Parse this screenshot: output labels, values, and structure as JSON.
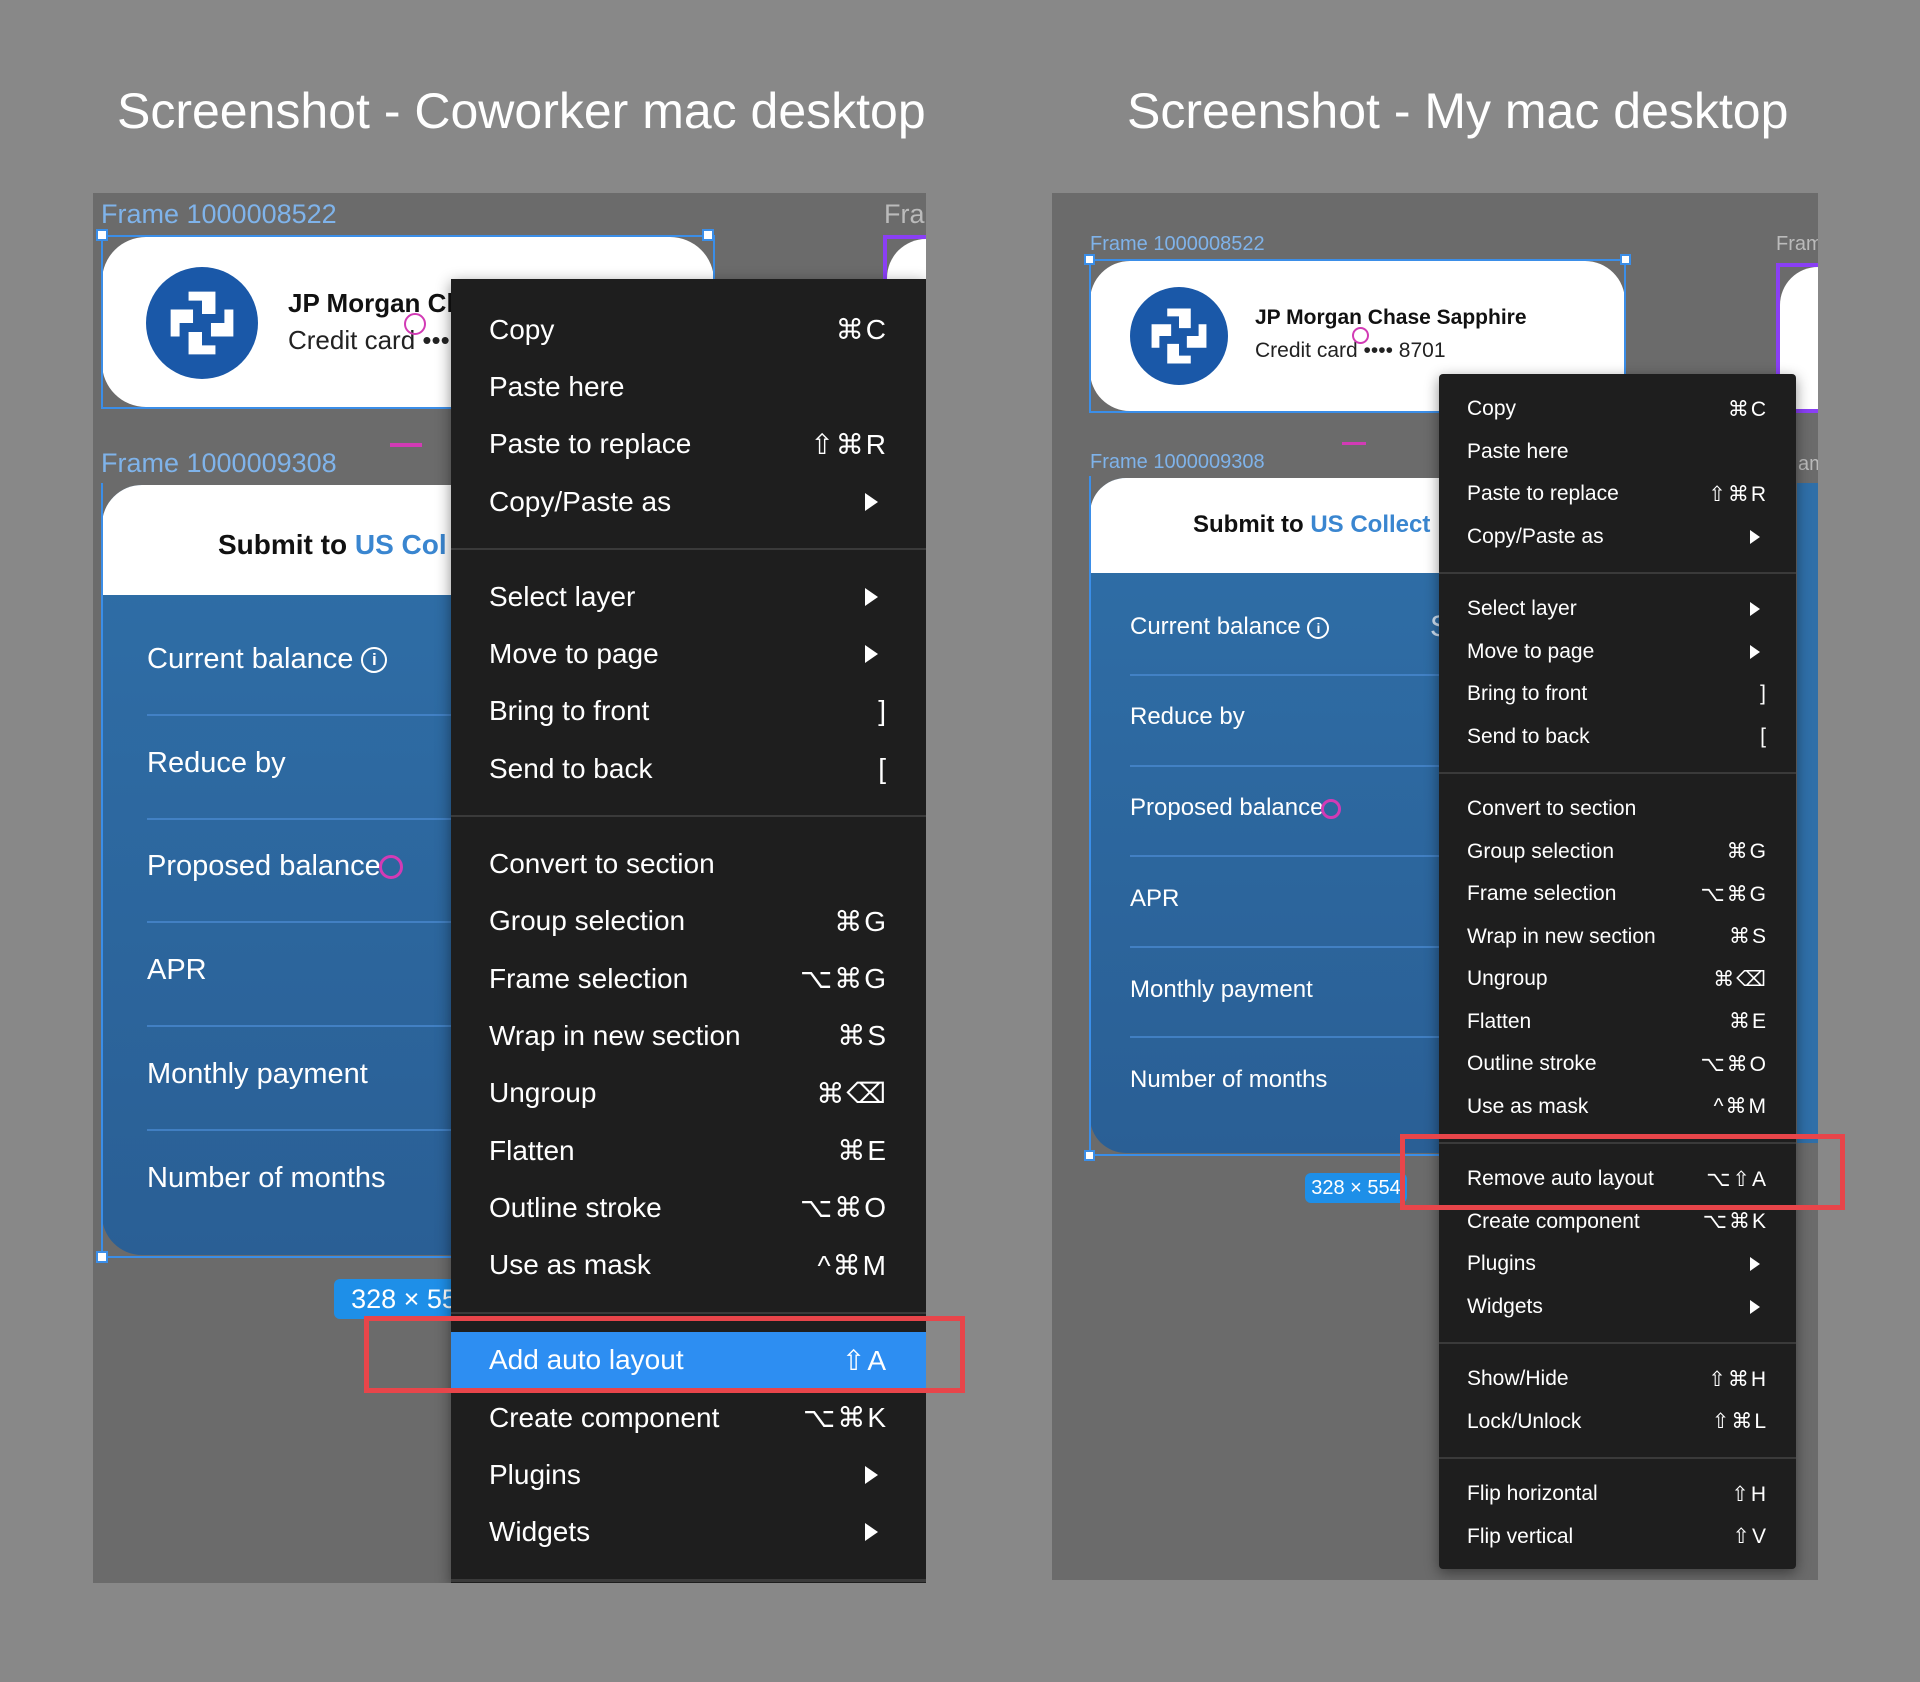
{
  "titles": {
    "left": "Screenshot - Coworker mac desktop",
    "right": "Screenshot - My mac desktop"
  },
  "colors": {
    "canvas_bg": "#6b6b6b",
    "page_bg": "#888888",
    "selection_blue": "#3b8ee8",
    "menu_bg": "#1e1e1e",
    "menu_highlight": "#2d8ef2",
    "annotation_red": "#e8454a",
    "form_blue": "#2f6fa8",
    "accent_text": "#3a86d0",
    "cursor_pink": "#d23bb5",
    "frame_purple": "#8a3ff5"
  },
  "left": {
    "frame1_label": "Frame 1000008522",
    "frame2_label": "Frame 1000009308",
    "frame3_label": "Fra",
    "card": {
      "bank_name": "JP Morgan Ch",
      "subtitle": "Credit card •••"
    },
    "form": {
      "header_prefix": "Submit to ",
      "header_accent": "US Col",
      "rows": [
        "Current balance",
        "Reduce by",
        "Proposed balance",
        "APR",
        "Monthly payment",
        "Number of months"
      ]
    },
    "dimension_badge": "328 × 55",
    "menu": {
      "items": [
        {
          "label": "Copy",
          "shortcut": "⌘C"
        },
        {
          "label": "Paste here",
          "shortcut": ""
        },
        {
          "label": "Paste to replace",
          "shortcut": "⇧⌘R"
        },
        {
          "label": "Copy/Paste as",
          "submenu": true
        },
        {
          "label": "Select layer",
          "submenu": true
        },
        {
          "label": "Move to page",
          "submenu": true
        },
        {
          "label": "Bring to front",
          "shortcut": "]"
        },
        {
          "label": "Send to back",
          "shortcut": "["
        },
        {
          "label": "Convert to section",
          "shortcut": ""
        },
        {
          "label": "Group selection",
          "shortcut": "⌘G"
        },
        {
          "label": "Frame selection",
          "shortcut": "⌥⌘G"
        },
        {
          "label": "Wrap in new section",
          "shortcut": "⌘S"
        },
        {
          "label": "Ungroup",
          "shortcut": "⌘⌫"
        },
        {
          "label": "Flatten",
          "shortcut": "⌘E"
        },
        {
          "label": "Outline stroke",
          "shortcut": "⌥⌘O"
        },
        {
          "label": "Use as mask",
          "shortcut": "^⌘M"
        },
        {
          "label": "Add auto layout",
          "shortcut": "⇧A",
          "highlighted": true
        },
        {
          "label": "Create component",
          "shortcut": "⌥⌘K"
        },
        {
          "label": "Plugins",
          "submenu": true
        },
        {
          "label": "Widgets",
          "submenu": true
        }
      ]
    }
  },
  "right": {
    "frame1_label": "Frame 1000008522",
    "frame2_label": "Frame 1000009308",
    "frame3_label": "Fram",
    "frame4_label": "am",
    "card": {
      "bank_name": "JP Morgan Chase Sapphire",
      "subtitle": "Credit card •••• 8701"
    },
    "form": {
      "header_prefix": "Submit to ",
      "header_accent": "US Collect",
      "rows": [
        "Current balance",
        "Reduce by",
        "Proposed balance",
        "APR",
        "Monthly payment",
        "Number of months"
      ],
      "clipped_value": "S"
    },
    "dimension_badge": "328 × 554",
    "menu": {
      "items": [
        {
          "label": "Copy",
          "shortcut": "⌘C"
        },
        {
          "label": "Paste here",
          "shortcut": ""
        },
        {
          "label": "Paste to replace",
          "shortcut": "⇧⌘R"
        },
        {
          "label": "Copy/Paste as",
          "submenu": true
        },
        {
          "label": "Select layer",
          "submenu": true
        },
        {
          "label": "Move to page",
          "submenu": true
        },
        {
          "label": "Bring to front",
          "shortcut": "]"
        },
        {
          "label": "Send to back",
          "shortcut": "["
        },
        {
          "label": "Convert to section",
          "shortcut": ""
        },
        {
          "label": "Group selection",
          "shortcut": "⌘G"
        },
        {
          "label": "Frame selection",
          "shortcut": "⌥⌘G"
        },
        {
          "label": "Wrap in new section",
          "shortcut": "⌘S"
        },
        {
          "label": "Ungroup",
          "shortcut": "⌘⌫"
        },
        {
          "label": "Flatten",
          "shortcut": "⌘E"
        },
        {
          "label": "Outline stroke",
          "shortcut": "⌥⌘O"
        },
        {
          "label": "Use as mask",
          "shortcut": "^⌘M"
        },
        {
          "label": "Remove auto layout",
          "shortcut": "⌥⇧A"
        },
        {
          "label": "Create component",
          "shortcut": "⌥⌘K"
        },
        {
          "label": "Plugins",
          "submenu": true
        },
        {
          "label": "Widgets",
          "submenu": true
        },
        {
          "label": "Show/Hide",
          "shortcut": "⇧⌘H"
        },
        {
          "label": "Lock/Unlock",
          "shortcut": "⇧⌘L"
        },
        {
          "label": "Flip horizontal",
          "shortcut": "⇧H"
        },
        {
          "label": "Flip vertical",
          "shortcut": "⇧V"
        }
      ]
    }
  }
}
